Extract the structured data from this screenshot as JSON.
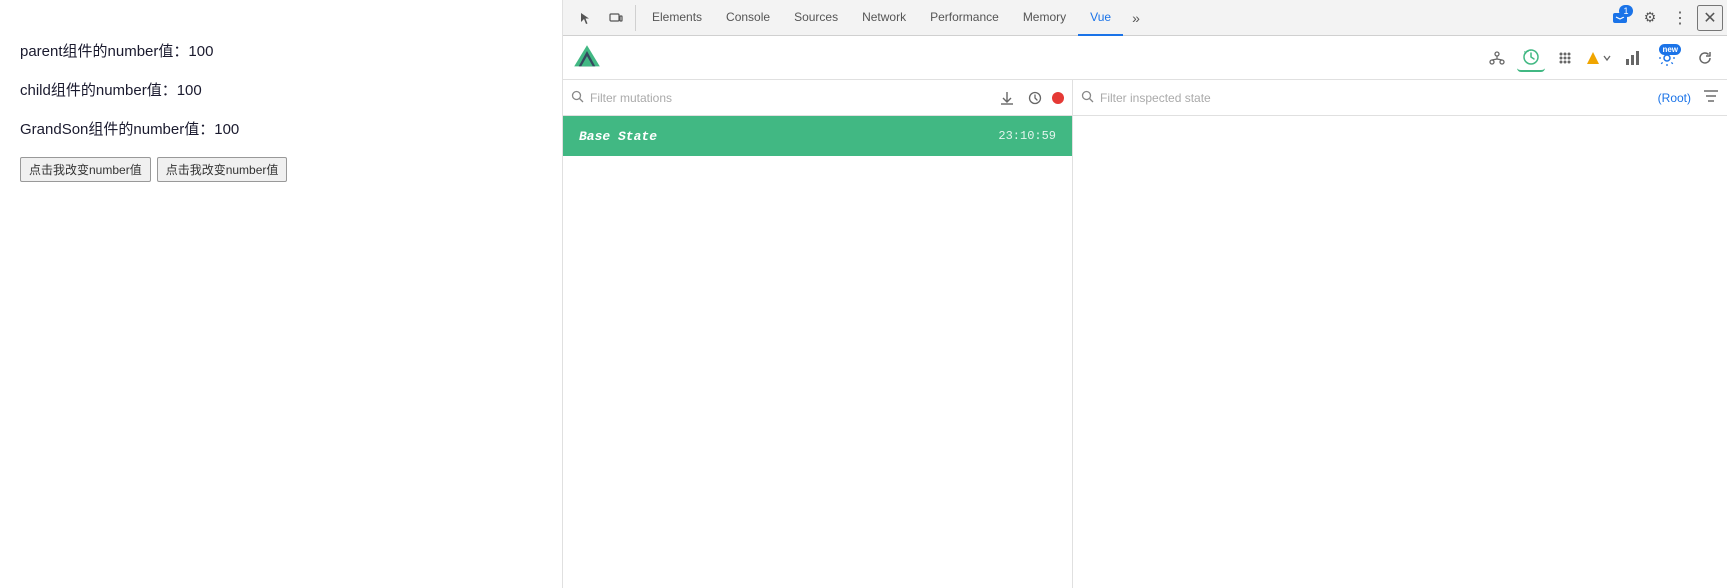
{
  "webpage": {
    "lines": [
      "parent组件的number值：100",
      "child组件的number值：100",
      "GrandSon组件的number值：100"
    ],
    "buttons": [
      "点击我改变number值",
      "点击我改变number值"
    ]
  },
  "devtools": {
    "tabs": [
      {
        "label": "Elements",
        "active": false
      },
      {
        "label": "Console",
        "active": false
      },
      {
        "label": "Sources",
        "active": false
      },
      {
        "label": "Network",
        "active": false
      },
      {
        "label": "Performance",
        "active": false
      },
      {
        "label": "Memory",
        "active": false
      },
      {
        "label": "Vue",
        "active": true
      }
    ],
    "more_tabs_icon": "»",
    "badge_count": "1",
    "settings_icon": "⚙",
    "more_icon": "⋮",
    "close_icon": "✕"
  },
  "vue_toolbar": {
    "tools": [
      {
        "name": "component-tree",
        "icon": "⑂",
        "active": false
      },
      {
        "name": "time-travel",
        "icon": "🕐",
        "active": true
      },
      {
        "name": "component-dot-grid",
        "icon": "⠿",
        "active": false
      },
      {
        "name": "route-dropdown",
        "icon": "◆",
        "active": false
      },
      {
        "name": "performance-bars",
        "icon": "▋",
        "active": false
      },
      {
        "name": "settings-new",
        "icon": "⚙",
        "badge": "new",
        "active": false
      }
    ],
    "refresh_icon": "↻"
  },
  "mutations_panel": {
    "filter_placeholder": "Filter mutations",
    "download_icon": "⬇",
    "clock_icon": "🕐",
    "record_active": true,
    "mutation_item": {
      "name": "Base State",
      "time": "23:10:59"
    }
  },
  "state_panel": {
    "filter_placeholder": "Filter inspected state",
    "root_label": "(Root)",
    "filter_icon": "☰"
  }
}
